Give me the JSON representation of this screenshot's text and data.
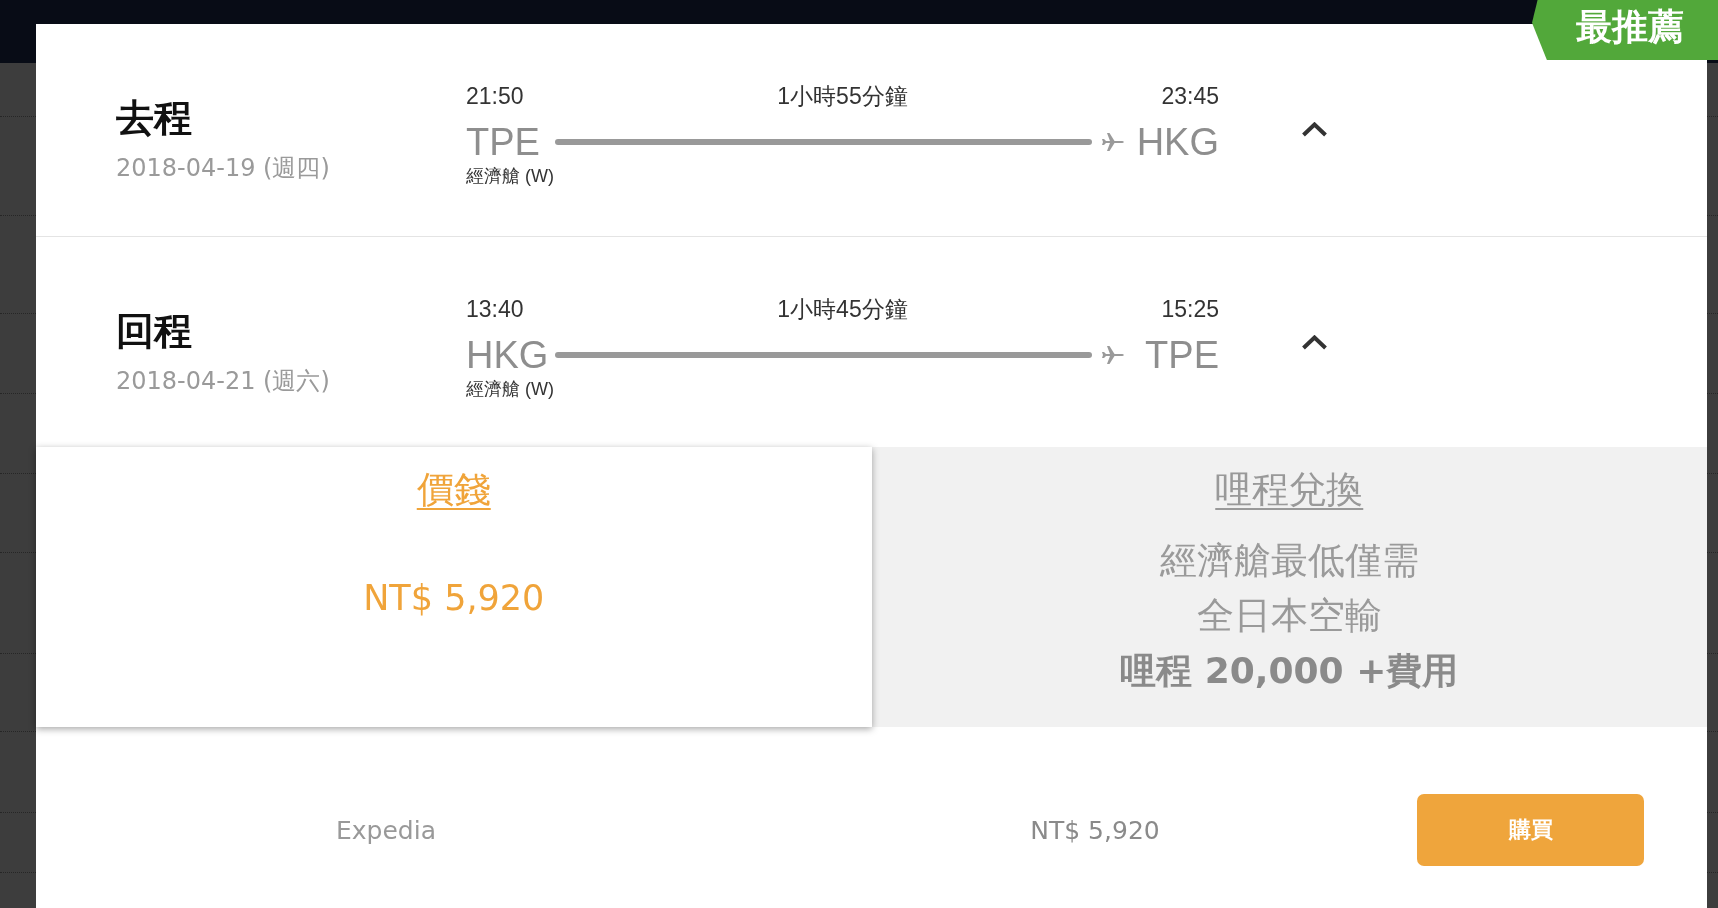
{
  "badge": {
    "label": "最推薦"
  },
  "legs": [
    {
      "title": "去程",
      "date": "2018-04-19 (週四)",
      "depart_time": "21:50",
      "duration": "1小時55分鐘",
      "arrive_time": "23:45",
      "origin": "TPE",
      "destination": "HKG",
      "cabin": "經濟艙 (W)",
      "expanded": true
    },
    {
      "title": "回程",
      "date": "2018-04-21 (週六)",
      "depart_time": "13:40",
      "duration": "1小時45分鐘",
      "arrive_time": "15:25",
      "origin": "HKG",
      "destination": "TPE",
      "cabin": "經濟艙 (W)",
      "expanded": true
    }
  ],
  "fare_tabs": [
    {
      "label": "價錢",
      "selected": true,
      "lines": [
        {
          "kind": "price",
          "text": "NT$ 5,920"
        }
      ]
    },
    {
      "label": "哩程兌換",
      "selected": false,
      "lines": [
        {
          "kind": "plain",
          "text": "經濟艙最低僅需"
        },
        {
          "kind": "plain",
          "text": "全日本空輸"
        },
        {
          "kind": "strong",
          "text": "哩程 20,000 +費用"
        }
      ]
    }
  ],
  "offers": [
    {
      "provider": "Expedia",
      "price": "NT$ 5,920",
      "button": "購買"
    }
  ]
}
